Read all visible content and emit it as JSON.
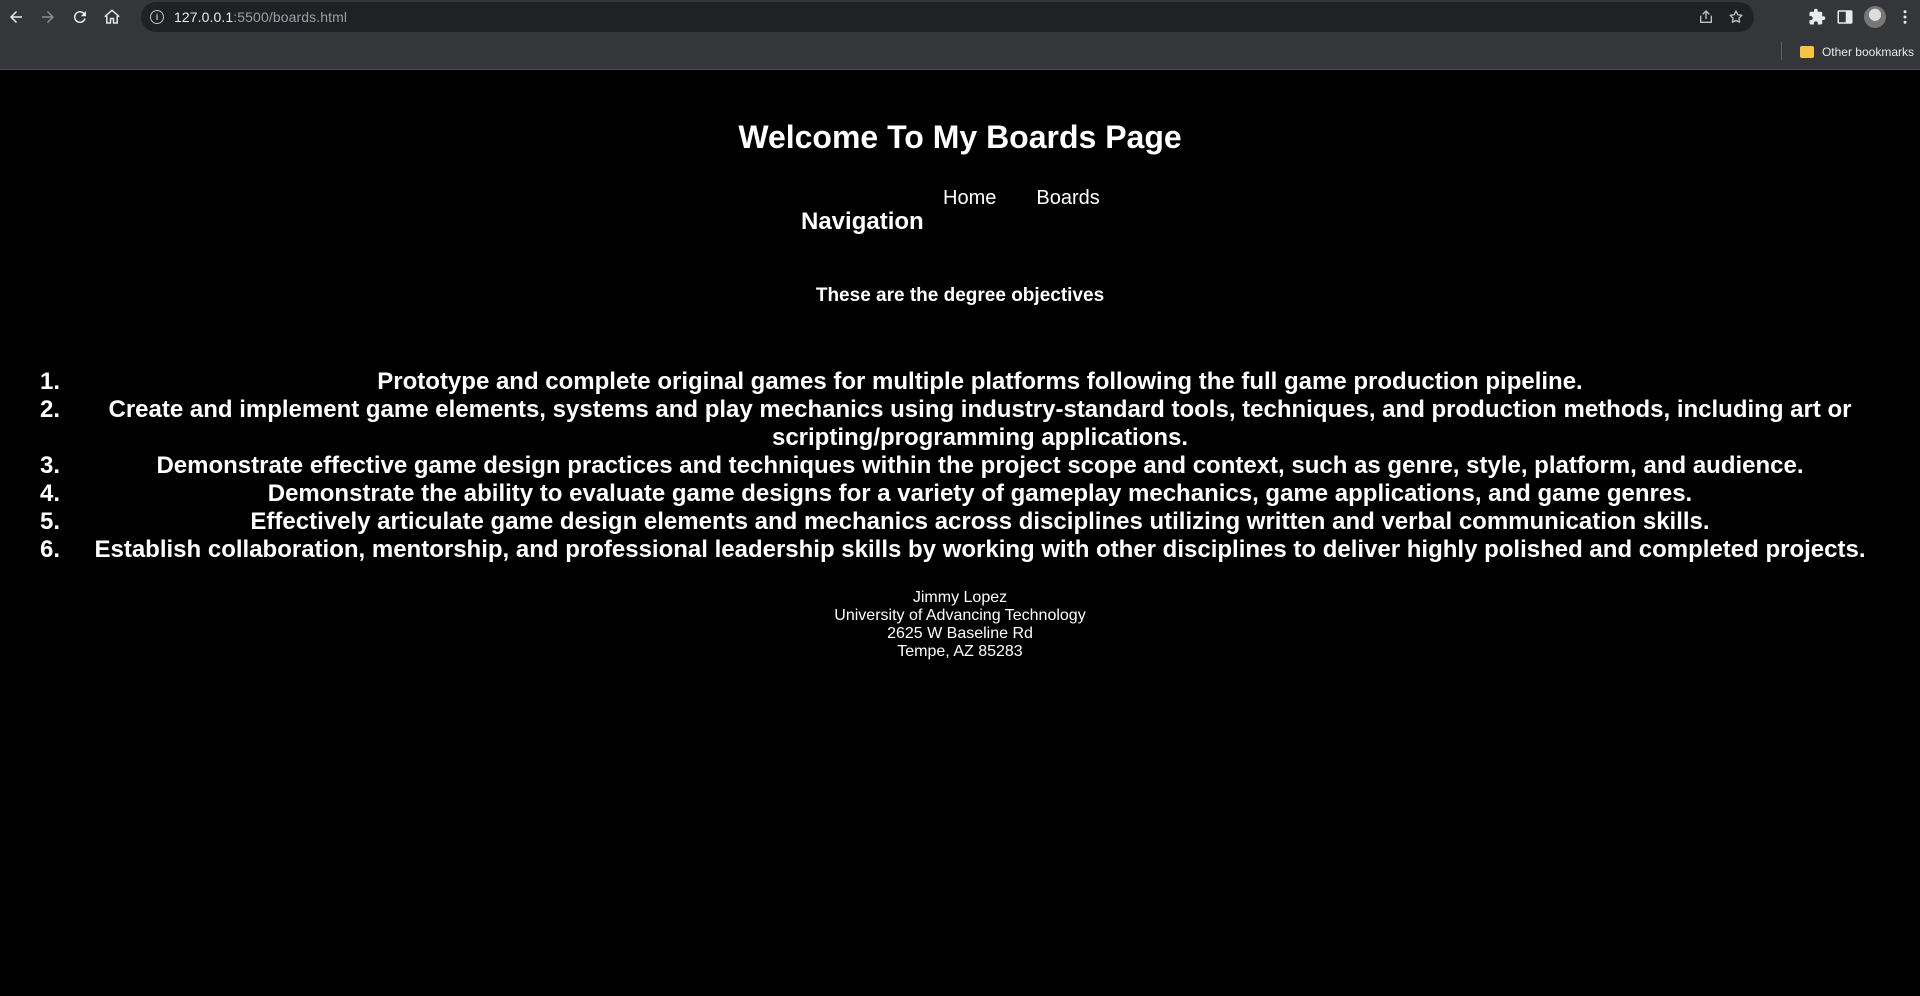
{
  "browser": {
    "url_host": "127.0.0.1",
    "url_path": ":5500/boards.html",
    "bookmarks": {
      "other": "Other bookmarks"
    }
  },
  "page": {
    "title": "Welcome To My Boards Page",
    "nav_heading": "Navigation",
    "nav_links": [
      "Home",
      "Boards"
    ],
    "objectives_heading": "These are the degree objectives",
    "objectives": [
      {
        "num": "1.",
        "text": "Prototype and complete original games for multiple platforms following the full game production pipeline."
      },
      {
        "num": "2.",
        "text": "Create and implement game elements, systems and play mechanics using industry-standard tools, techniques, and production methods, including art or scripting/programming applications."
      },
      {
        "num": "3.",
        "text": "Demonstrate effective game design practices and techniques within the project scope and context, such as genre, style, platform, and audience."
      },
      {
        "num": "4.",
        "text": "Demonstrate the ability to evaluate game designs for a variety of gameplay mechanics, game applications, and game genres."
      },
      {
        "num": "5.",
        "text": "Effectively articulate game design elements and mechanics across disciplines utilizing written and verbal communication skills."
      },
      {
        "num": "6.",
        "text": "Establish collaboration, mentorship, and professional leadership skills by working with other disciplines to deliver highly polished and completed projects."
      }
    ],
    "footer": {
      "name": "Jimmy Lopez",
      "school": "University of Advancing Technology",
      "street": "2625 W Baseline Rd",
      "city": "Tempe, AZ 85283"
    }
  },
  "colors": {
    "page_bg": "#000000",
    "page_text": "#ffffff",
    "chrome_bg": "#35363a",
    "omnibox_bg": "#202124"
  }
}
